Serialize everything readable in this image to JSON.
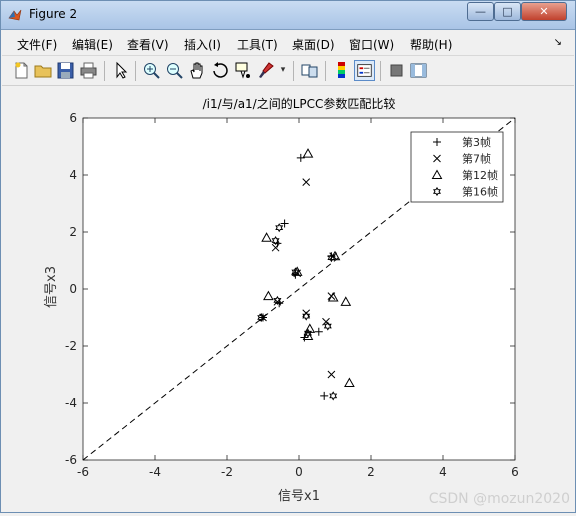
{
  "window": {
    "title": "Figure 2",
    "minimize_label": "—",
    "maximize_label": "□",
    "close_label": "✕"
  },
  "menu": {
    "items": [
      "文件(F)",
      "编辑(E)",
      "查看(V)",
      "插入(I)",
      "工具(T)",
      "桌面(D)",
      "窗口(W)",
      "帮助(H)"
    ],
    "overflow_arrow": "↘"
  },
  "toolbar": {
    "icons": [
      "new-figure-icon",
      "open-file-icon",
      "save-icon",
      "print-icon",
      "edit-plot-arrow-icon",
      "zoom-in-icon",
      "zoom-out-icon",
      "pan-hand-icon",
      "rotate-3d-icon",
      "data-cursor-icon",
      "brush-icon",
      "link-plot-icon",
      "colorbar-icon",
      "legend-icon",
      "hide-plot-tools-icon",
      "show-plot-tools-icon"
    ]
  },
  "watermark": "CSDN @mozun2020",
  "chart_data": {
    "type": "scatter",
    "title": "/i1/与/a1/之间的LPCC参数匹配比较",
    "xlabel": "信号x1",
    "ylabel": "信号x3",
    "xlim": [
      -6,
      6
    ],
    "ylim": [
      -6,
      6
    ],
    "xticks": [
      -6,
      -4,
      -2,
      0,
      2,
      4,
      6
    ],
    "yticks": [
      -6,
      -4,
      -2,
      0,
      2,
      4,
      6
    ],
    "grid": false,
    "legend_position": "top-right",
    "reference_line": {
      "style": "dashed",
      "from": [
        -6,
        -6
      ],
      "to": [
        6,
        6
      ]
    },
    "series": [
      {
        "name": "第3帧",
        "marker": "+",
        "points": [
          [
            0.05,
            4.6
          ],
          [
            -0.4,
            2.3
          ],
          [
            -0.6,
            1.6
          ],
          [
            0.9,
            1.15
          ],
          [
            -0.1,
            0.5
          ],
          [
            -1.0,
            -1.0
          ],
          [
            -0.55,
            -0.5
          ],
          [
            0.15,
            -1.7
          ],
          [
            0.55,
            -1.5
          ],
          [
            0.7,
            -3.75
          ]
        ]
      },
      {
        "name": "第7帧",
        "marker": "x",
        "points": [
          [
            0.2,
            3.75
          ],
          [
            -0.65,
            1.45
          ],
          [
            0.95,
            1.15
          ],
          [
            -0.05,
            0.55
          ],
          [
            -0.6,
            -0.45
          ],
          [
            0.9,
            -0.25
          ],
          [
            0.2,
            -0.85
          ],
          [
            0.75,
            -1.15
          ],
          [
            -1.0,
            -1.0
          ],
          [
            0.9,
            -3.0
          ]
        ]
      },
      {
        "name": "第12帧",
        "marker": "triangle",
        "points": [
          [
            0.25,
            4.75
          ],
          [
            -0.9,
            1.8
          ],
          [
            1.0,
            1.15
          ],
          [
            -0.05,
            0.6
          ],
          [
            -0.85,
            -0.25
          ],
          [
            0.95,
            -0.3
          ],
          [
            1.3,
            -0.45
          ],
          [
            0.3,
            -1.4
          ],
          [
            0.25,
            -1.65
          ],
          [
            1.4,
            -3.3
          ]
        ]
      },
      {
        "name": "第16帧",
        "marker": "hexagram",
        "points": [
          [
            -0.55,
            2.15
          ],
          [
            -0.65,
            1.7
          ],
          [
            -0.1,
            0.6
          ],
          [
            0.9,
            1.1
          ],
          [
            -1.05,
            -1.0
          ],
          [
            -0.6,
            -0.4
          ],
          [
            0.2,
            -0.95
          ],
          [
            0.8,
            -1.3
          ],
          [
            0.25,
            -1.55
          ],
          [
            0.95,
            -3.75
          ]
        ]
      }
    ]
  }
}
